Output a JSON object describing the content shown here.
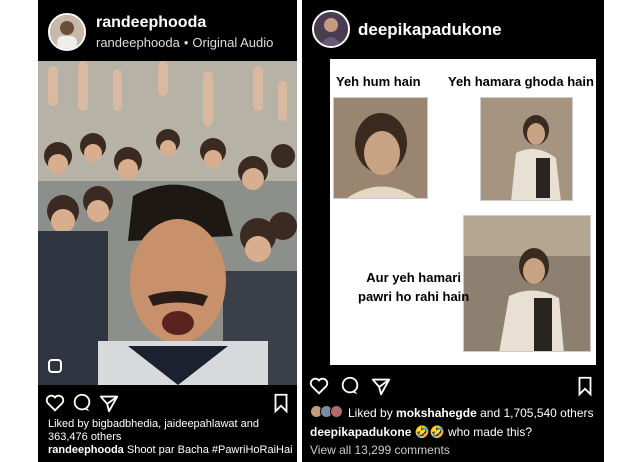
{
  "left_post": {
    "username": "randeephooda",
    "sub_user": "randeephooda",
    "audio": "Original Audio",
    "likes_line1": "Liked by bigbadbhedia, jaideepahlawat and",
    "likes_line2": "363,476 others",
    "caption_user": "randeephooda",
    "caption_text": "Shoot par Bacha #PawriHoRaiHai"
  },
  "right_post": {
    "username": "deepikapadukone",
    "meme": {
      "text1": "Yeh hum hain",
      "text2": "Yeh hamara ghoda hain",
      "text3_line1": "Aur yeh hamari",
      "text3_line2": "pawri ho rahi hain"
    },
    "likes_prefix": "Liked by",
    "likes_user": "mokshahegde",
    "likes_suffix": "and 1,705,540 others",
    "caption_user": "deepikapadukone",
    "caption_emoji": "🤣🤣",
    "caption_text": "who made this?",
    "view_all": "View all 13,299 comments"
  },
  "colors": {
    "background": "#000000",
    "text": "#ffffff"
  }
}
